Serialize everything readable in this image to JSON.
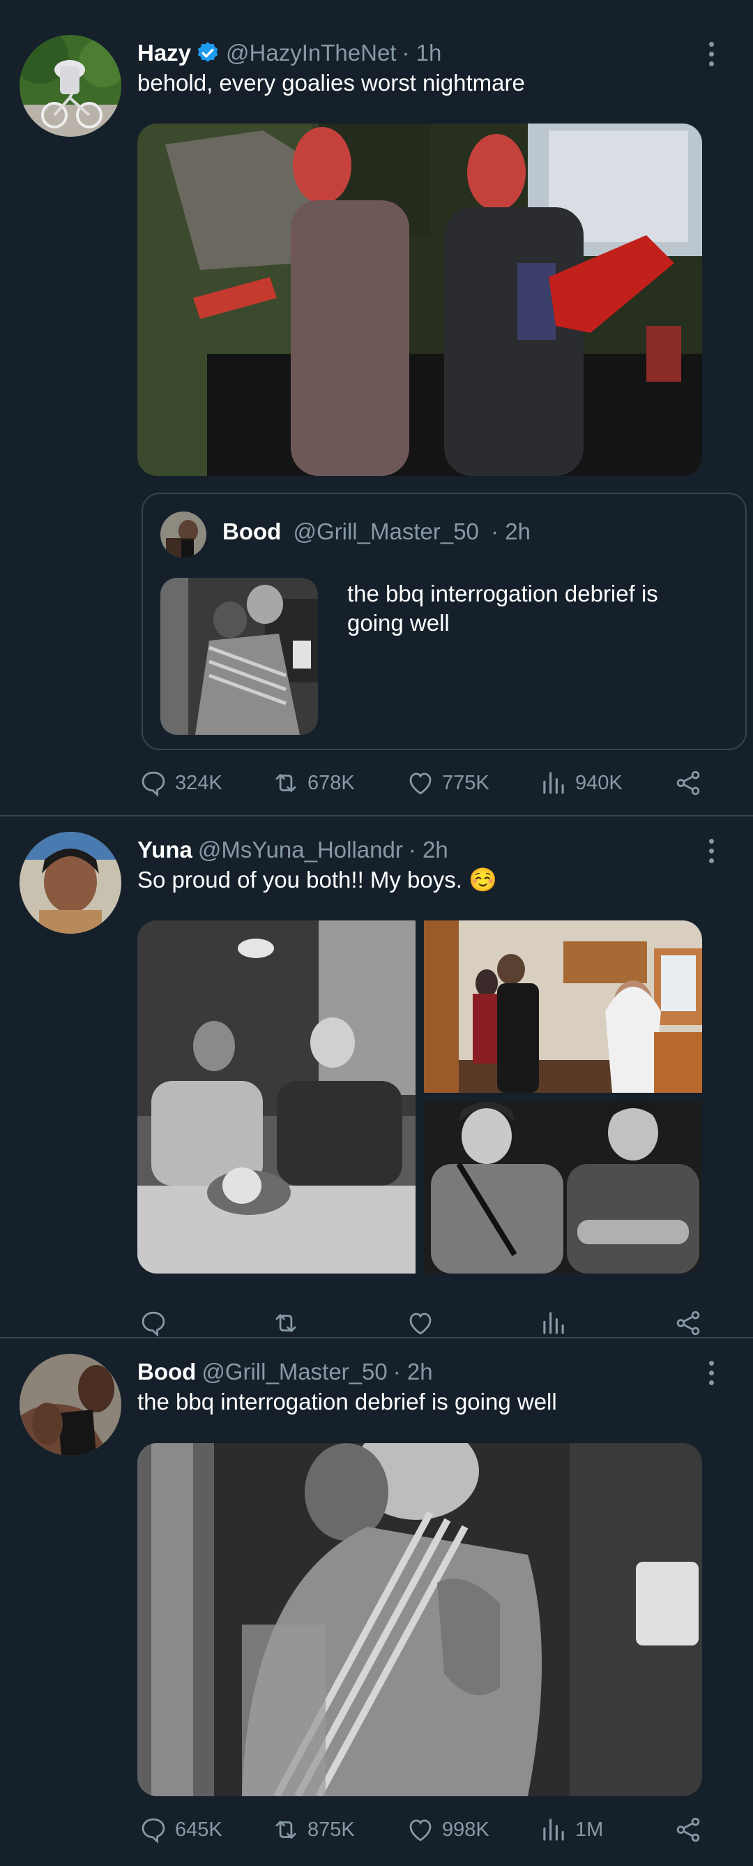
{
  "colors": {
    "background": "#15202b",
    "divider": "#38444d",
    "secondary_text": "#8899a6",
    "verified": "#1d9bf0",
    "primary_text": "#ffffff"
  },
  "tweets": [
    {
      "name": "Hazy",
      "verified": true,
      "handle": "@HazyInTheNet",
      "time": "· 1h",
      "text": "behold, every goalies worst nightmare",
      "avatar_icon": "person-bicycle-avatar",
      "media_description": "photo",
      "quote": {
        "name": "Bood",
        "handle": "@Grill_Master_50",
        "time": "· 2h",
        "text_line1": "the bbq interrogation debrief is",
        "text_line2": "going well"
      },
      "stats": {
        "replies": "324K",
        "retweets": "678K",
        "likes": "775K",
        "views": "940K"
      }
    },
    {
      "name": "Yuna",
      "verified": false,
      "handle": "@MsYuna_Hollandr",
      "time": "· 2h",
      "text": "So proud of you both!! My boys. ☺️",
      "stats": {
        "replies": "",
        "retweets": "",
        "likes": "",
        "views": ""
      }
    },
    {
      "name": "Bood",
      "verified": false,
      "handle": "@Grill_Master_50",
      "time": "· 2h",
      "text": "the bbq interrogation debrief is going well",
      "stats": {
        "replies": "645K",
        "retweets": "875K",
        "likes": "998K",
        "views": "1M"
      }
    }
  ],
  "icons": [
    "reply-icon",
    "retweet-icon",
    "like-icon",
    "views-icon",
    "share-icon",
    "more-icon",
    "verified-badge-icon"
  ]
}
